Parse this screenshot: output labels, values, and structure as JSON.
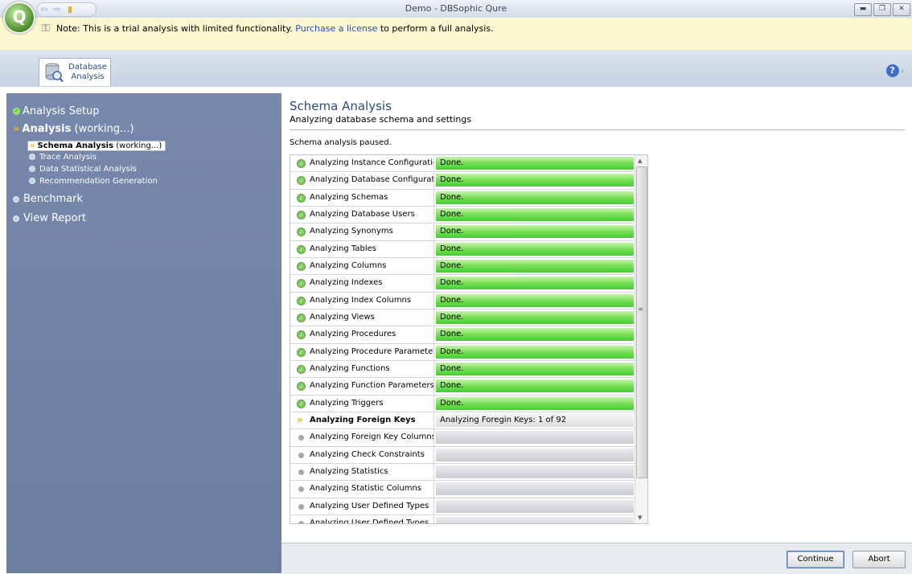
{
  "window": {
    "title": "Demo - DBSophic Qure"
  },
  "trial": {
    "text_before": "Note: This is a trial analysis with limited functionality. ",
    "link": "Purchase a license",
    "text_after": " to perform a full analysis."
  },
  "ribbon": {
    "tab_line1": "Database",
    "tab_line2": "Analysis",
    "help_icon": "help-icon"
  },
  "sidebar": {
    "analysis_setup": "Analysis Setup",
    "analysis": "Analysis",
    "analysis_state": "(working...)",
    "schema_analysis": "Schema Analysis",
    "schema_state": "(working...)",
    "trace_analysis": "Trace Analysis",
    "data_statistical": "Data Statistical Analysis",
    "recommendation": "Recommendation Generation",
    "benchmark": "Benchmark",
    "view_report": "View Report"
  },
  "main": {
    "title": "Schema Analysis",
    "subtitle": "Analyzing database schema and settings",
    "status": "Schema analysis paused."
  },
  "tasks": [
    {
      "name": "Analyzing Instance Configurations",
      "state": "done",
      "progress": "Done."
    },
    {
      "name": "Analyzing Database Configurations",
      "state": "done",
      "progress": "Done."
    },
    {
      "name": "Analyzing Schemas",
      "state": "done",
      "progress": "Done."
    },
    {
      "name": "Analyzing Database Users",
      "state": "done",
      "progress": "Done."
    },
    {
      "name": "Analyzing Synonyms",
      "state": "done",
      "progress": "Done."
    },
    {
      "name": "Analyzing Tables",
      "state": "done",
      "progress": "Done."
    },
    {
      "name": "Analyzing Columns",
      "state": "done",
      "progress": "Done."
    },
    {
      "name": "Analyzing Indexes",
      "state": "done",
      "progress": "Done."
    },
    {
      "name": "Analyzing Index Columns",
      "state": "done",
      "progress": "Done."
    },
    {
      "name": "Analyzing Views",
      "state": "done",
      "progress": "Done."
    },
    {
      "name": "Analyzing Procedures",
      "state": "done",
      "progress": "Done."
    },
    {
      "name": "Analyzing Procedure Parameters",
      "state": "done",
      "progress": "Done."
    },
    {
      "name": "Analyzing Functions",
      "state": "done",
      "progress": "Done."
    },
    {
      "name": "Analyzing Function Parameters",
      "state": "done",
      "progress": "Done."
    },
    {
      "name": "Analyzing Triggers",
      "state": "done",
      "progress": "Done."
    },
    {
      "name": "Analyzing Foreign Keys",
      "state": "working",
      "progress": "Analyzing Foregin Keys: 1 of 92"
    },
    {
      "name": "Analyzing Foreign Key Columns",
      "state": "pending",
      "progress": ""
    },
    {
      "name": "Analyzing Check Constraints",
      "state": "pending",
      "progress": ""
    },
    {
      "name": "Analyzing Statistics",
      "state": "pending",
      "progress": ""
    },
    {
      "name": "Analyzing Statistic Columns",
      "state": "pending",
      "progress": ""
    },
    {
      "name": "Analyzing User Defined Types",
      "state": "pending",
      "progress": ""
    },
    {
      "name": "Analyzing User Defined Types",
      "state": "pending",
      "progress": ""
    }
  ],
  "buttons": {
    "continue": "Continue",
    "abort": "Abort"
  },
  "colors": {
    "done_bar": "#45cc35",
    "sidebar_bg": "#6c7fa0",
    "title_blue": "#2b4c84",
    "trial_bg": "#fcf7cf"
  }
}
